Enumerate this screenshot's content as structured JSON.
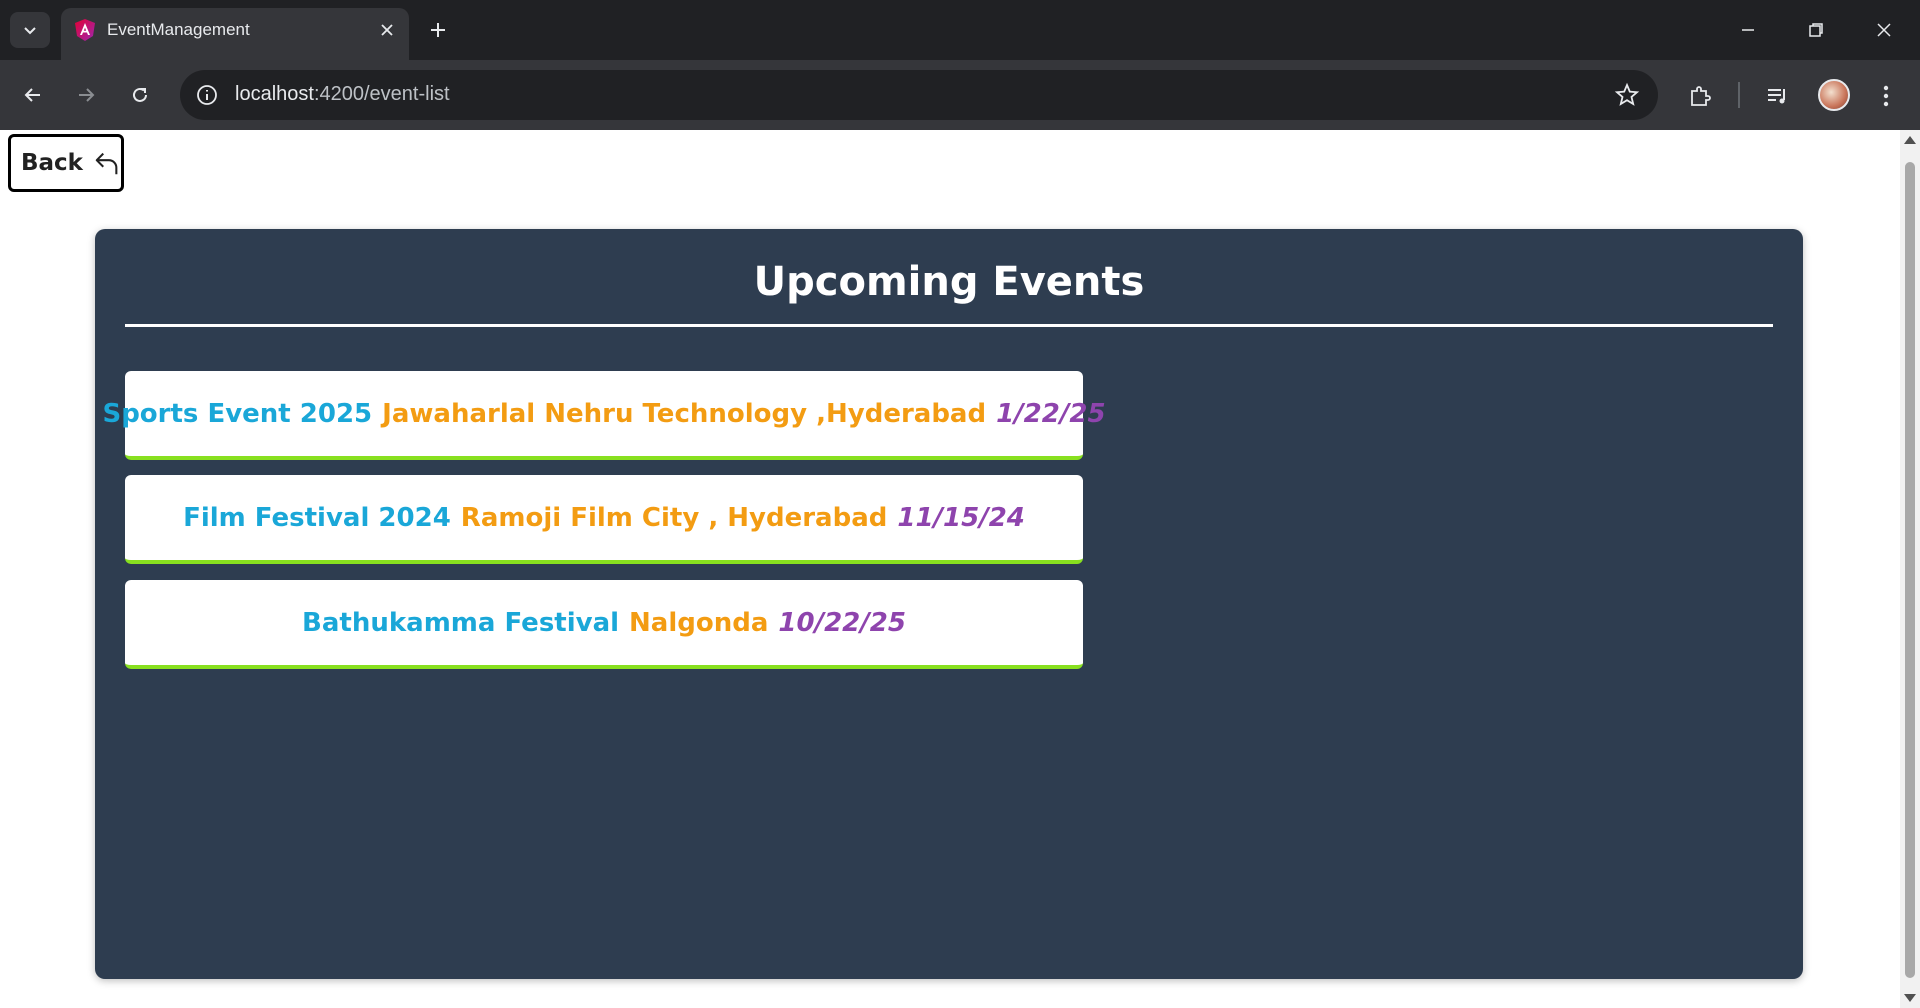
{
  "browser": {
    "tab_title": "EventManagement",
    "url_host": "localhost",
    "url_path": ":4200/event-list"
  },
  "page": {
    "back_label": "Back",
    "heading": "Upcoming Events",
    "events": [
      {
        "name": "Sports Event 2025",
        "venue": "Jawaharlal Nehru Technology ,Hyderabad",
        "date": "1/22/25"
      },
      {
        "name": "Film Festival 2024",
        "venue": "Ramoji Film City , Hyderabad",
        "date": "11/15/24"
      },
      {
        "name": "Bathukamma Festival",
        "venue": "Nalgonda",
        "date": "10/22/25"
      }
    ]
  },
  "colors": {
    "panel_bg": "#2e3d50",
    "event_name": "#1aa7d8",
    "event_venue": "#f39c12",
    "event_date": "#8e44ad",
    "card_accent": "#88e01f"
  },
  "icons": {
    "back": "undo-arrow-icon",
    "favicon": "angular-logo-icon"
  }
}
